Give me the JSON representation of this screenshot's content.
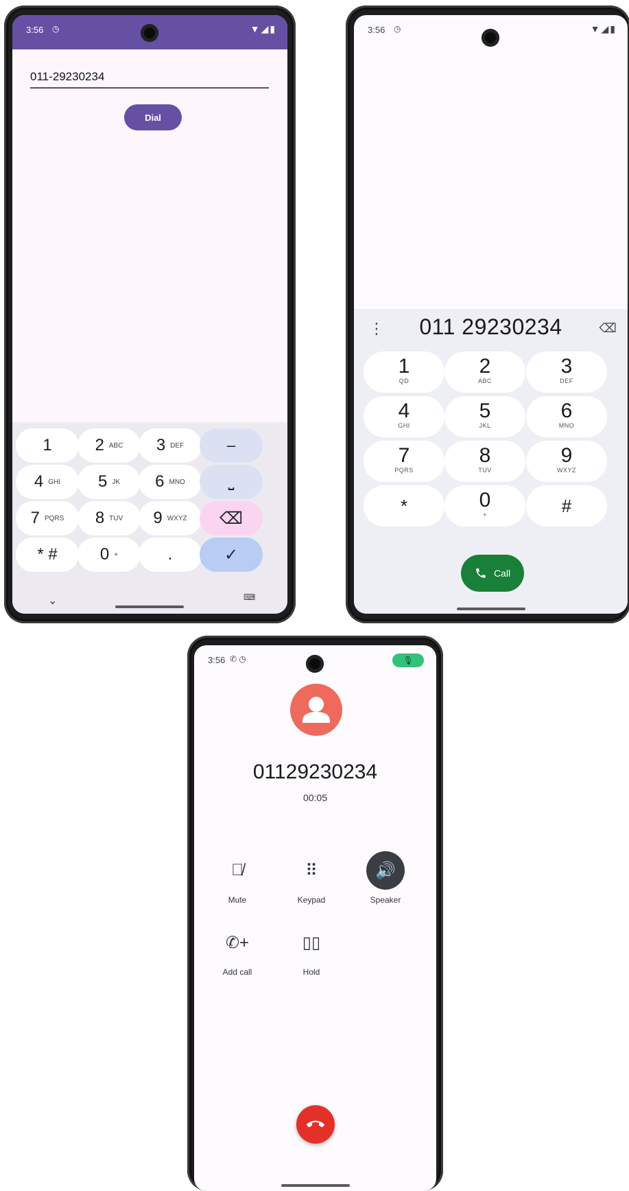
{
  "phone1": {
    "status": {
      "time": "3:56",
      "alarm_icon": "alarm-icon",
      "signal": "▼◢▮"
    },
    "number_field": {
      "value": "011-29230234"
    },
    "dial_label": "Dial",
    "keyboard": {
      "rows": [
        [
          {
            "main": "1",
            "sub": ""
          },
          {
            "main": "2",
            "sub": "ABC"
          },
          {
            "main": "3",
            "sub": "DEF"
          },
          {
            "main": "–",
            "sub": "",
            "kind": "fn"
          }
        ],
        [
          {
            "main": "4",
            "sub": "GHI"
          },
          {
            "main": "5",
            "sub": "JK"
          },
          {
            "main": "6",
            "sub": "MNO"
          },
          {
            "main": "⎵",
            "sub": "",
            "kind": "fn"
          }
        ],
        [
          {
            "main": "7",
            "sub": "PQRS"
          },
          {
            "main": "8",
            "sub": "TUV"
          },
          {
            "main": "9",
            "sub": "WXYZ"
          },
          {
            "main": "⌫",
            "sub": "",
            "kind": "del"
          }
        ],
        [
          {
            "main": "* #",
            "sub": ""
          },
          {
            "main": "0",
            "sub": "+"
          },
          {
            "main": ".",
            "sub": ""
          },
          {
            "main": "✓",
            "sub": "",
            "kind": "ok"
          }
        ]
      ],
      "hide_icon": "chevron-down-icon",
      "switch_icon": "keyboard-icon"
    }
  },
  "phone2": {
    "status": {
      "time": "3:56",
      "signal": "▼◢▮"
    },
    "entered_digits": "011 29230234",
    "menu_icon": "more-vert-icon",
    "backspace_icon": "backspace-icon",
    "keys": [
      {
        "d": "1",
        "l": "QD"
      },
      {
        "d": "2",
        "l": "ABC"
      },
      {
        "d": "3",
        "l": "DEF"
      },
      {
        "d": "4",
        "l": "GHI"
      },
      {
        "d": "5",
        "l": "JKL"
      },
      {
        "d": "6",
        "l": "MNO"
      },
      {
        "d": "7",
        "l": "PQRS"
      },
      {
        "d": "8",
        "l": "TUV"
      },
      {
        "d": "9",
        "l": "WXYZ"
      },
      {
        "d": "*",
        "l": ""
      },
      {
        "d": "0",
        "l": "+"
      },
      {
        "d": "#",
        "l": ""
      }
    ],
    "call_label": "Call"
  },
  "phone3": {
    "status": {
      "time": "3:56",
      "mic": "🎙"
    },
    "caller_number": "01129230234",
    "call_timer": "00:05",
    "controls": [
      {
        "label": "Mute",
        "icon": "mic-off-icon",
        "active": false
      },
      {
        "label": "Keypad",
        "icon": "dialpad-icon",
        "active": false
      },
      {
        "label": "Speaker",
        "icon": "speaker-icon",
        "active": true
      },
      {
        "label": "Add call",
        "icon": "add-call-icon",
        "active": false
      },
      {
        "label": "Hold",
        "icon": "pause-icon",
        "active": false
      }
    ],
    "end_icon": "end-call-icon"
  },
  "colors": {
    "purple": "#6650a4",
    "call_green": "#188038",
    "end_red": "#e3312a",
    "avatar": "#ee6a5d",
    "speaker_active": "#3b3d45"
  }
}
